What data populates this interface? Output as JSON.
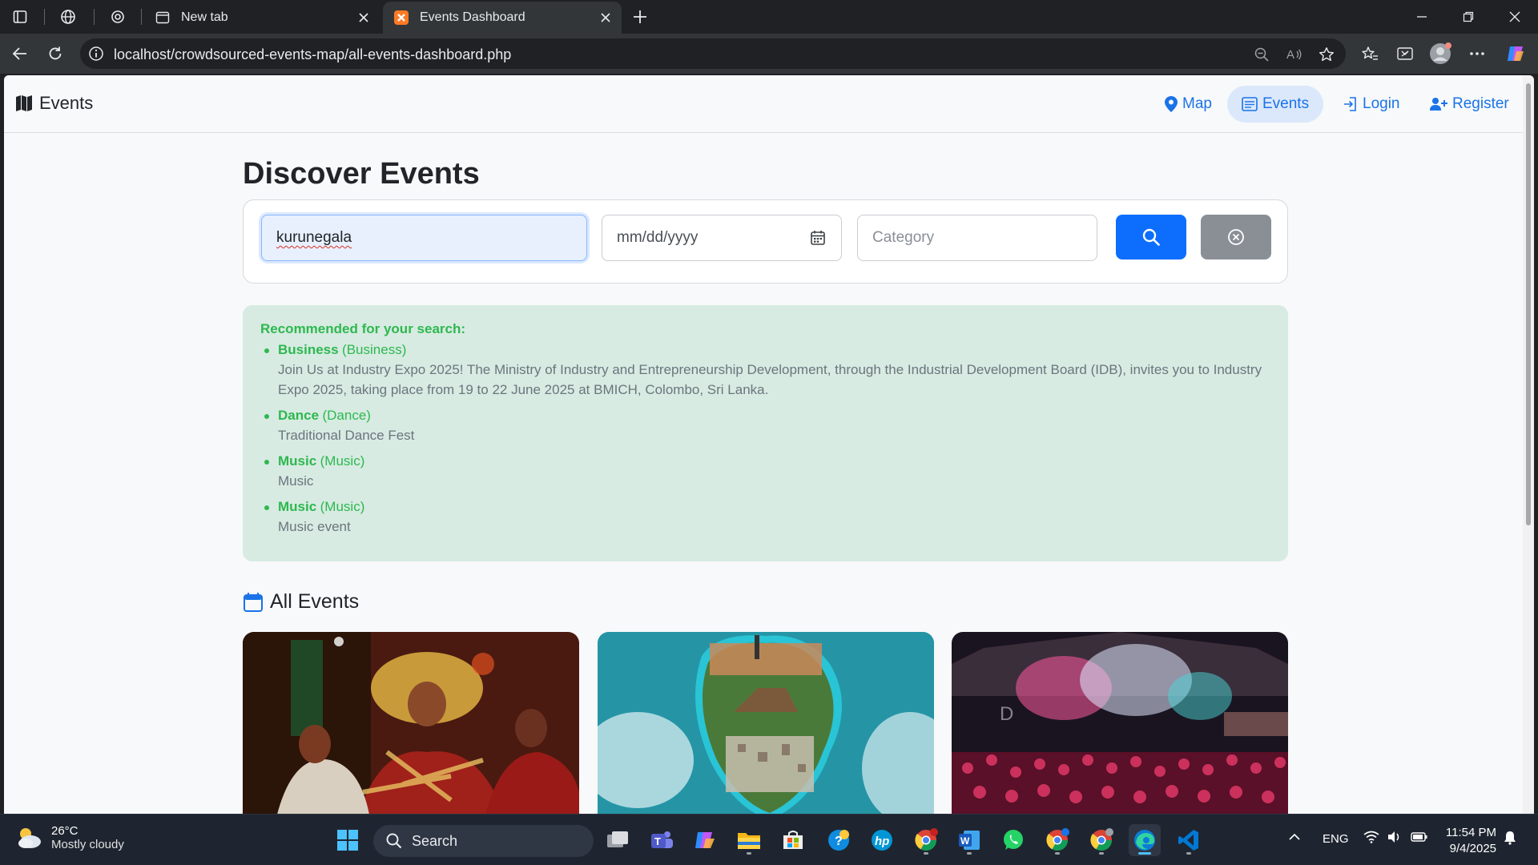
{
  "browser": {
    "tabs": [
      {
        "title": "New tab",
        "active": false
      },
      {
        "title": "Events Dashboard",
        "active": true
      }
    ],
    "url": "localhost/crowdsourced-events-map/all-events-dashboard.php"
  },
  "site": {
    "brand": "Events",
    "nav": [
      {
        "label": "Map",
        "icon": "map-pin-icon",
        "active": false
      },
      {
        "label": "Events",
        "icon": "list-icon",
        "active": true
      },
      {
        "label": "Login",
        "icon": "login-icon",
        "active": false
      },
      {
        "label": "Register",
        "icon": "user-plus-icon",
        "active": false
      }
    ]
  },
  "page": {
    "title": "Discover Events",
    "search": {
      "location_value": "kurunegala",
      "date_placeholder": "mm/dd/yyyy",
      "category_placeholder": "Category"
    },
    "recommendations": {
      "title": "Recommended for your search:",
      "items": [
        {
          "name": "Business",
          "category": "(Business)",
          "description": "Join Us at Industry Expo 2025! The Ministry of Industry and Entrepreneurship Development, through the Industrial Development Board (IDB), invites you to Industry Expo 2025, taking place from 19 to 22 June 2025 at BMICH, Colombo, Sri Lanka."
        },
        {
          "name": "Dance",
          "category": "(Dance)",
          "description": "Traditional Dance Fest"
        },
        {
          "name": "Music",
          "category": "(Music)",
          "description": "Music"
        },
        {
          "name": "Music",
          "category": "(Music)",
          "description": "Music event"
        }
      ]
    },
    "all_events_title": "All Events"
  },
  "taskbar": {
    "weather_temp": "26°C",
    "weather_desc": "Mostly cloudy",
    "search_label": "Search",
    "language": "ENG",
    "time": "11:54 PM",
    "date": "9/4/2025"
  },
  "colors": {
    "accent": "#0d6efd",
    "link": "#1a73e8",
    "reco_bg": "#d7ebe2",
    "reco_text": "#2eb84f"
  }
}
